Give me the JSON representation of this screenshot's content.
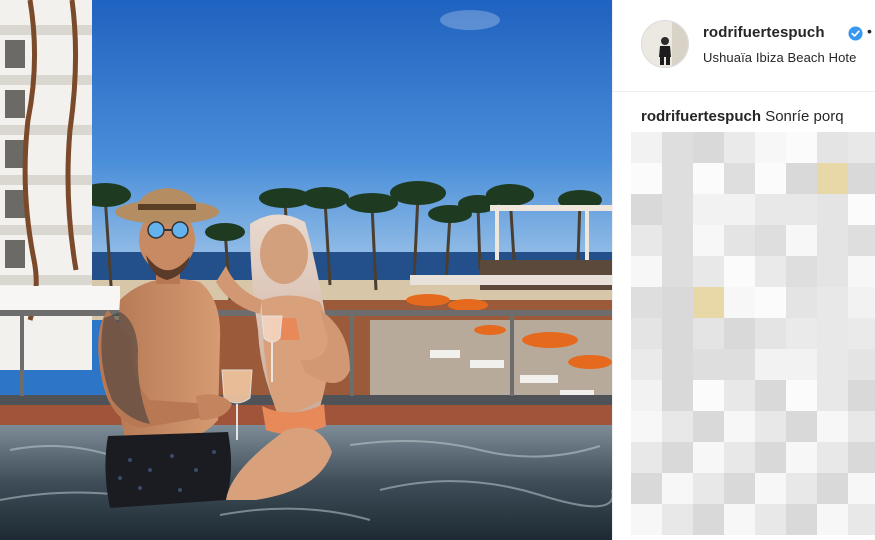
{
  "post": {
    "username": "rodrifuertespuch",
    "verified": true,
    "separator": "•",
    "location": "Ushuaïa Ibiza Beach Hote",
    "caption": {
      "username": "rodrifuertespuch",
      "text": "Sonríe porq"
    },
    "comments_blurred": true
  },
  "icons": {
    "verified_badge": "verified-badge-icon",
    "avatar": "profile-avatar"
  },
  "colors": {
    "verified_blue": "#3897f0",
    "text_primary": "#262626",
    "border": "#efefef"
  }
}
